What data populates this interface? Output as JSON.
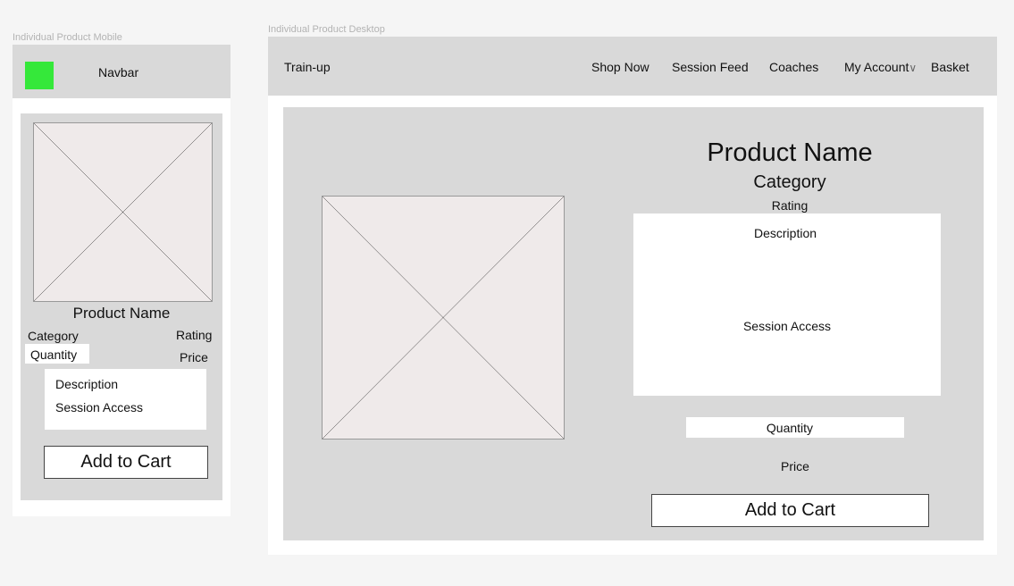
{
  "mobile": {
    "frame_label": "Individual Product Mobile",
    "navbar_label": "Navbar",
    "logo_color": "#35e83a",
    "product_name": "Product Name",
    "category": "Category",
    "rating": "Rating",
    "quantity": "Quantity",
    "price": "Price",
    "description": "Description",
    "session_access": "Session Access",
    "add_to_cart": "Add to Cart"
  },
  "desktop": {
    "frame_label": "Individual Product Desktop",
    "brand": "Train-up",
    "nav": {
      "shop_now": "Shop Now",
      "session_feed": "Session Feed",
      "coaches": "Coaches",
      "my_account": "My Account",
      "basket": "Basket"
    },
    "product_name": "Product Name",
    "category": "Category",
    "rating": "Rating",
    "description": "Description",
    "session_access": "Session Access",
    "quantity": "Quantity",
    "price": "Price",
    "add_to_cart": "Add to Cart"
  }
}
